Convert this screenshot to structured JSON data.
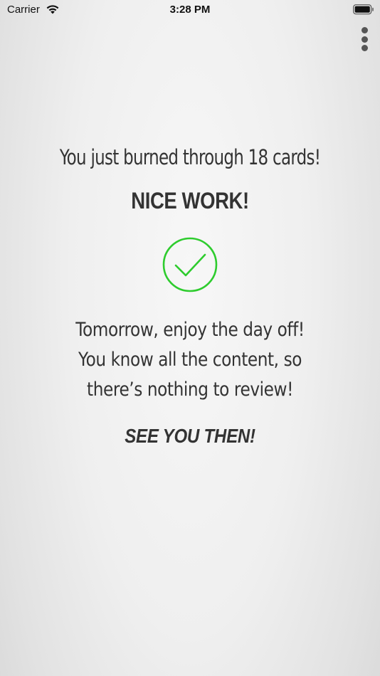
{
  "status_bar": {
    "carrier": "Carrier",
    "time": "3:28 PM"
  },
  "summary": {
    "burned_text": "You just burned through 18 cards!",
    "headline": "NICE WORK!",
    "message_lines": [
      "Tomorrow, enjoy the day off!",
      "You know all the content, so",
      "there’s nothing to review!"
    ],
    "signoff": "SEE YOU THEN!"
  },
  "colors": {
    "check_green": "#2ecc2e",
    "text": "#333333"
  },
  "icons": {
    "menu": "more-vertical-icon",
    "success": "checkmark-circle-icon",
    "wifi": "wifi-icon",
    "battery": "battery-icon"
  }
}
